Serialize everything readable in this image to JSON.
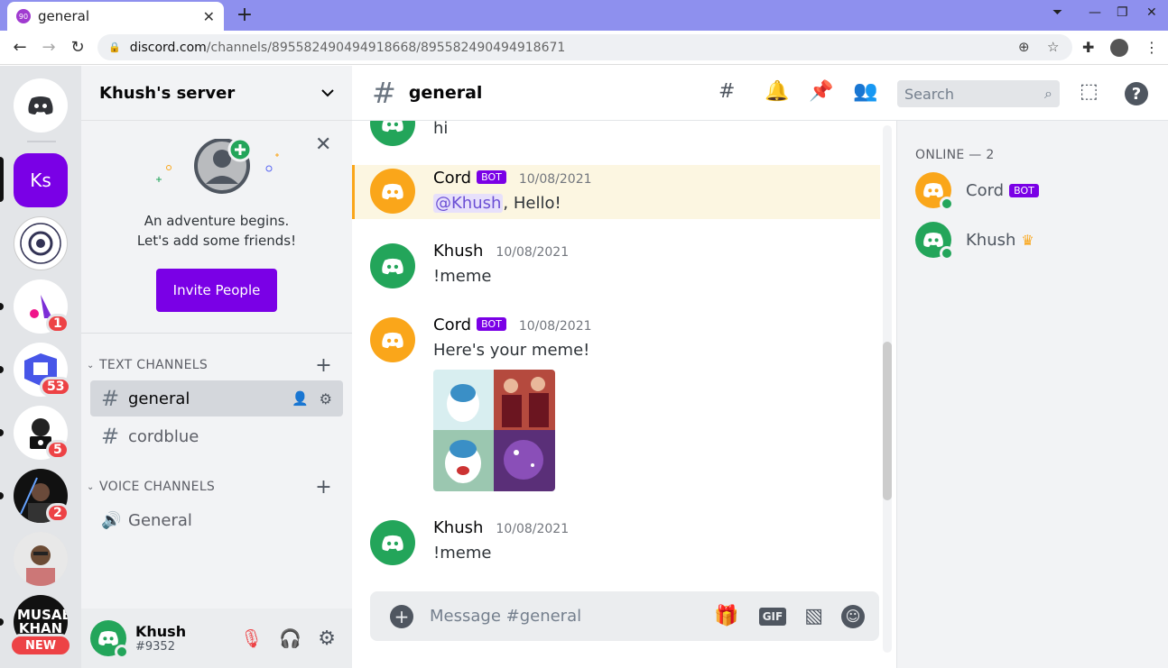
{
  "browser": {
    "tab_title": "general",
    "favicon_text": "90",
    "url_host": "discord.com",
    "url_path": "/channels/895582490494918668/895582490494918671"
  },
  "server": {
    "name": "Khush's server",
    "promo_line1": "An adventure begins.",
    "promo_line2": "Let's add some friends!",
    "invite_label": "Invite People",
    "text_category": "TEXT CHANNELS",
    "voice_category": "VOICE CHANNELS",
    "text_channels": [
      "general",
      "cordblue"
    ],
    "voice_channels": [
      "General"
    ]
  },
  "guilds": [
    {
      "label": "Ks",
      "badge": "",
      "color": "#7a00e6"
    },
    {
      "label": "",
      "badge": "1",
      "color": "#ffffff"
    },
    {
      "label": "",
      "badge": "53",
      "color": "#ffffff"
    },
    {
      "label": "",
      "badge": "5",
      "color": "#ffffff"
    },
    {
      "label": "",
      "badge": "2",
      "color": "#111111"
    },
    {
      "label": "",
      "badge": "",
      "color": "#dddddd"
    },
    {
      "label": "MUSAB KHAN",
      "badge": "",
      "color": "#111111"
    }
  ],
  "new_label": "NEW",
  "user": {
    "name": "Khush",
    "tag": "#9352"
  },
  "chat": {
    "channel": "general",
    "search_placeholder": "Search",
    "composer_placeholder": "Message #general",
    "gif_label": "GIF",
    "messages": [
      {
        "author": "",
        "time": "",
        "body": "hi"
      },
      {
        "author": "Cord",
        "bot": "BOT",
        "time": "10/08/2021",
        "mention": "@Khush",
        "body": ", Hello!"
      },
      {
        "author": "Khush",
        "time": "10/08/2021",
        "body": "!meme"
      },
      {
        "author": "Cord",
        "bot": "BOT",
        "time": "10/08/2021",
        "body": "Here's your meme!"
      },
      {
        "author": "Khush",
        "time": "10/08/2021",
        "body": "!meme"
      }
    ]
  },
  "members": {
    "heading": "ONLINE — 2",
    "list": [
      {
        "name": "Cord",
        "bot": "BOT",
        "color": "#faa61a"
      },
      {
        "name": "Khush",
        "crown": "♛",
        "color": "#23a55a"
      }
    ]
  },
  "colors": {
    "accent": "#7a00e6",
    "online": "#23a55a",
    "bot_avatar": "#faa61a",
    "user_avatar": "#23a55a"
  }
}
